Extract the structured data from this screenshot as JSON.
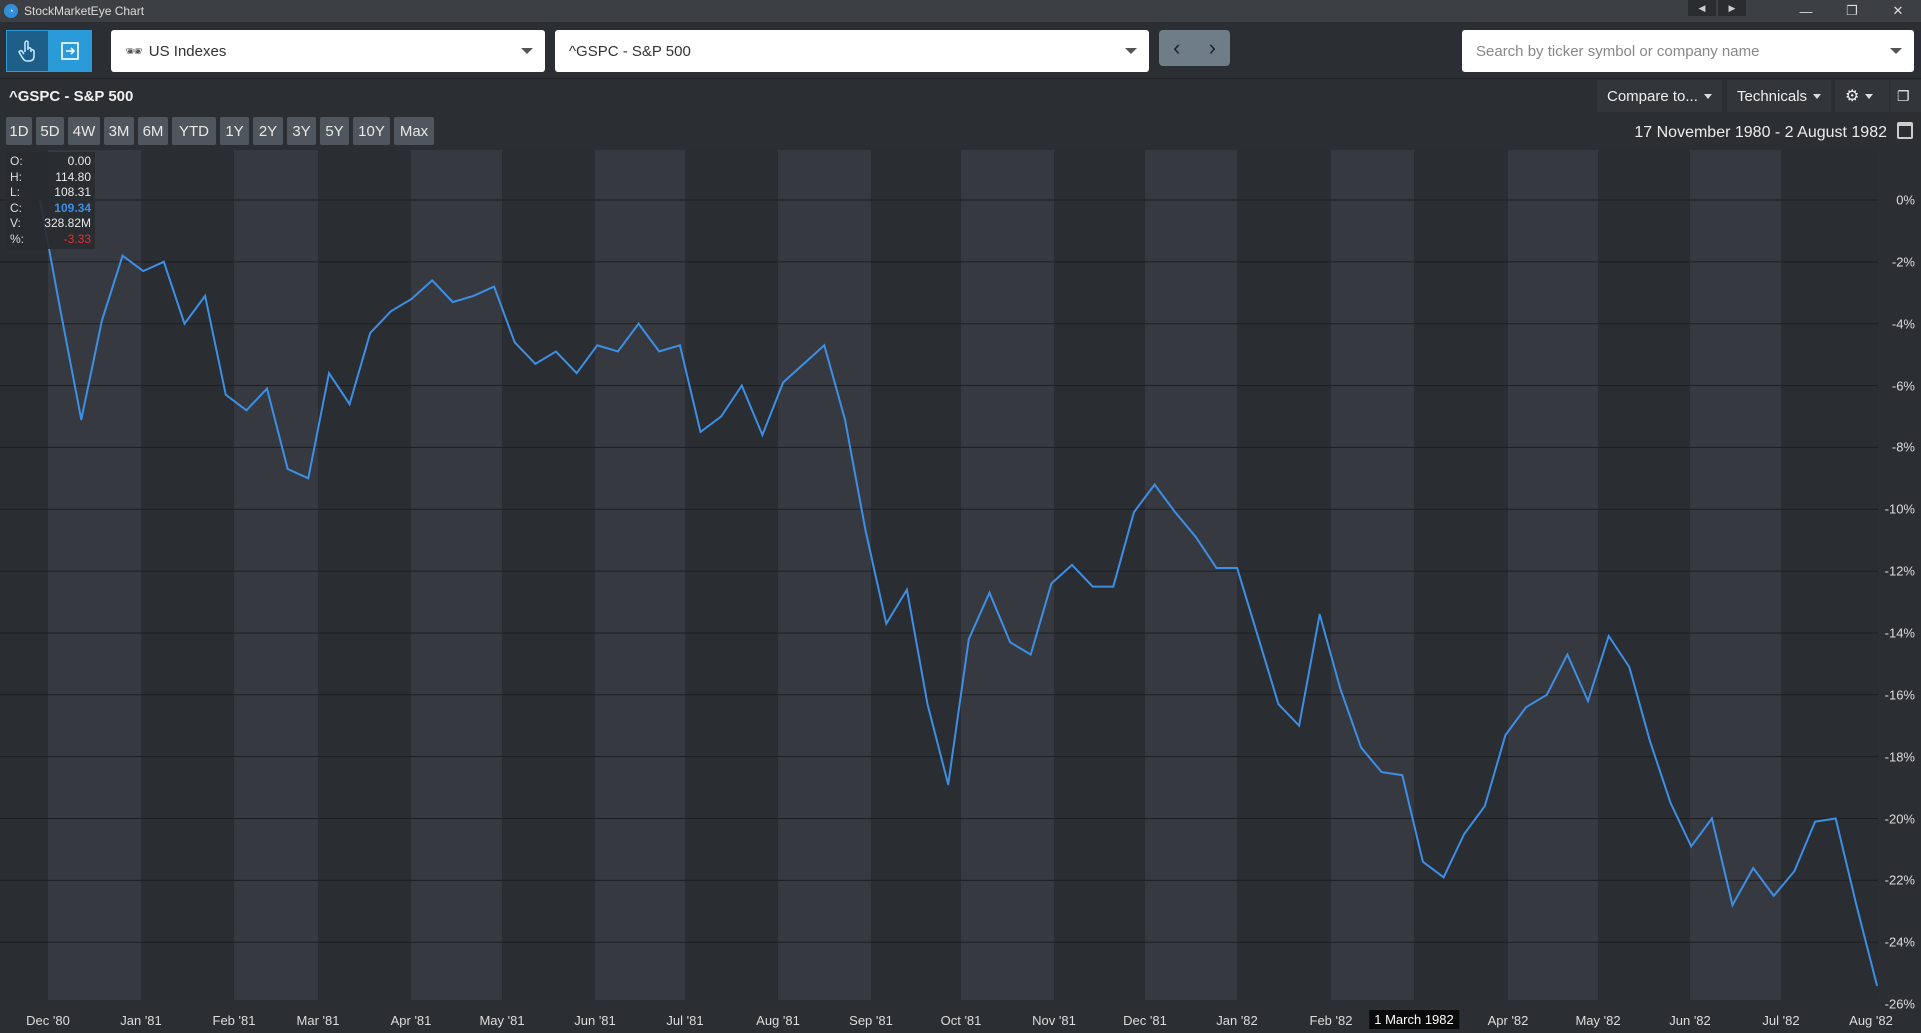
{
  "window": {
    "title": "StockMarketEye Chart"
  },
  "toolbar": {
    "list_select": "US Indexes",
    "symbol_select": "^GSPC - S&P 500",
    "search_placeholder": "Search by ticker symbol or company name"
  },
  "header": {
    "title": "^GSPC - S&P 500",
    "compare_label": "Compare to...",
    "technicals_label": "Technicals"
  },
  "ranges": [
    "1D",
    "5D",
    "4W",
    "3M",
    "6M",
    "YTD",
    "1Y",
    "2Y",
    "3Y",
    "5Y",
    "10Y",
    "Max"
  ],
  "date_range": "17 November 1980 - 2 August 1982",
  "ohlc": {
    "rows": [
      {
        "k": "O:",
        "v": "0.00"
      },
      {
        "k": "H:",
        "v": "114.80"
      },
      {
        "k": "L:",
        "v": "108.31"
      },
      {
        "k": "C:",
        "v": "109.34"
      },
      {
        "k": "V:",
        "v": "328.82M"
      },
      {
        "k": "%:",
        "v": "-3.33"
      }
    ]
  },
  "colors": {
    "line": "#3d8fe6",
    "accent": "#2a9bd8",
    "band_dark": "#2a2d32",
    "band_light": "#363a40"
  },
  "chart_data": {
    "type": "line",
    "series": [
      {
        "values": [
          0.0,
          -3.6,
          -7.1,
          -3.9,
          -1.8,
          -2.3,
          -2.0,
          -4.0,
          -3.1,
          -6.3,
          -6.8,
          -6.1,
          -8.7,
          -9.0,
          -5.6,
          -6.6,
          -4.3,
          -3.6,
          -3.2,
          -2.6,
          -3.3,
          -3.1,
          -2.8,
          -4.6,
          -5.3,
          -4.9,
          -5.6,
          -4.7,
          -4.9,
          -4.0,
          -4.9,
          -4.7,
          -7.5,
          -7.0,
          -6.0,
          -7.6,
          -5.9,
          -5.3,
          -4.7,
          -7.1,
          -10.7,
          -13.7,
          -12.6,
          -16.3,
          -18.9,
          -14.2,
          -12.7,
          -14.3,
          -14.7,
          -12.4,
          -11.8,
          -12.5,
          -12.5,
          -10.1,
          -9.2,
          -10.1,
          -10.9,
          -11.9,
          -11.9,
          -14.1,
          -16.3,
          -17.0,
          -13.4,
          -15.8,
          -17.7,
          -18.5,
          -18.6,
          -21.4,
          -21.9,
          -20.5,
          -19.6,
          -17.3,
          -16.4,
          -16.0,
          -14.7,
          -16.2,
          -14.1,
          -15.1,
          -17.5,
          -19.5,
          -20.9,
          -20.0,
          -22.8,
          -21.6,
          -22.5,
          -21.7,
          -20.1,
          -20.0,
          -22.8,
          -25.4
        ]
      }
    ],
    "ylim": [
      -26,
      0
    ],
    "y_ticks": [
      "0%",
      "-2%",
      "-4%",
      "-6%",
      "-8%",
      "-10%",
      "-12%",
      "-14%",
      "-16%",
      "-18%",
      "-20%",
      "-22%",
      "-24%",
      "-26%"
    ],
    "x_ticks": [
      "Dec '80",
      "Jan '81",
      "Feb '81",
      "Mar '81",
      "Apr '81",
      "May '81",
      "Jun '81",
      "Jul '81",
      "Aug '81",
      "Sep '81",
      "Oct '81",
      "Nov '81",
      "Dec '81",
      "Jan '82",
      "Feb '82",
      "1 March 1982",
      "Apr '82",
      "May '82",
      "Jun '82",
      "Jul '82",
      "Aug '82"
    ],
    "highlighted_tick": "1 March 1982"
  }
}
